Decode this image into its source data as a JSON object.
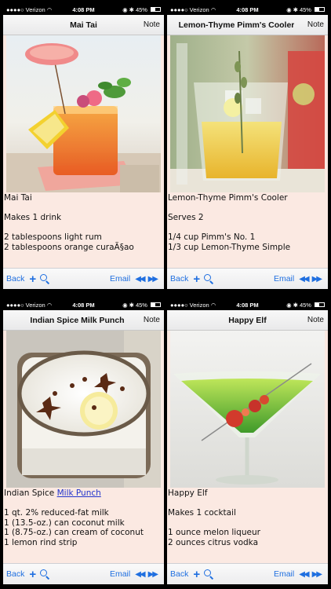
{
  "status": {
    "carrier": "Verizon",
    "time": "4:08 PM",
    "battery": "45%"
  },
  "toolbar": {
    "back": "Back",
    "plus": "+",
    "email": "Email",
    "prev": "◀◀",
    "next": "▶▶"
  },
  "screens": [
    {
      "title": "Mai Tai",
      "note": "Note",
      "lines": [
        "Mai Tai",
        "",
        "Makes 1 drink",
        "",
        "2 tablespoons light rum",
        "2 tablespoons orange curaÃ§ao"
      ]
    },
    {
      "title": "Lemon-Thyme Pimm's Cooler",
      "note": "Note",
      "lines": [
        "Lemon-Thyme Pimm's Cooler",
        "",
        "Serves 2",
        "",
        "1/4 cup Pimm's No. 1",
        "1/3 cup Lemon-Thyme Simple"
      ]
    },
    {
      "title": "Indian Spice Milk Punch",
      "note": "Note",
      "first_line_plain": "Indian Spice ",
      "first_line_link": "Milk Punch",
      "lines": [
        "",
        "1 qt. 2% reduced-fat milk",
        "1 (13.5-oz.) can coconut milk",
        "1 (8.75-oz.) can cream of coconut",
        "1 lemon rind strip"
      ]
    },
    {
      "title": "Happy Elf",
      "note": "Note",
      "lines": [
        "Happy Elf",
        "",
        "Makes 1 cocktail",
        "",
        "1 ounce melon liqueur",
        "2 ounces citrus vodka"
      ]
    }
  ]
}
